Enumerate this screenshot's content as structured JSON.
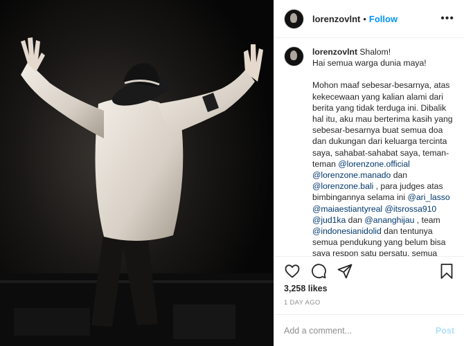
{
  "post": {
    "username": "lorenzovlnt",
    "follow_label": "Follow",
    "dot": "•",
    "more_label": "•••",
    "caption_lines": [
      [
        "Shalom!"
      ],
      [
        "Hai semua warga dunia maya!"
      ],
      [],
      [
        "Mohon maaf sebesar-besarnya, atas kekecewaan yang kalian alami dari berita yang tidak terduga ini. Dibalik hal itu, aku mau berterima kasih yang sebesar-besarnya buat semua doa dan dukungan dari keluarga tercinta saya, sahabat-sahabat saya, teman-teman ",
        {
          "m": "@lorenzone.official"
        },
        " ",
        {
          "m": "@lorenzone.manado"
        },
        " dan ",
        {
          "m": "@lorenzone.bali"
        },
        " , para judges atas bimbingannya selama ini ",
        {
          "m": "@ari_lasso"
        },
        " ",
        {
          "m": "@maiaestiantyreal"
        },
        " ",
        {
          "m": "@itsrossa910"
        },
        " ",
        {
          "m": "@jud1ka"
        },
        " dan ",
        {
          "m": "@ananghijau"
        },
        " , team ",
        {
          "m": "@indonesianidolid"
        },
        " dan tentunya semua pendukung yang belum bisa saya respon satu persatu, semua pesan-pesan kalian benar-benar sangat berarti untuk aku tetap"
      ]
    ],
    "likes": "3,258 likes",
    "time": "1 DAY AGO",
    "comment_placeholder": "Add a comment...",
    "post_label": "Post",
    "colors": {
      "accent": "#0095f6",
      "mention": "#00376b",
      "post_disabled": "#b2dffc"
    }
  }
}
